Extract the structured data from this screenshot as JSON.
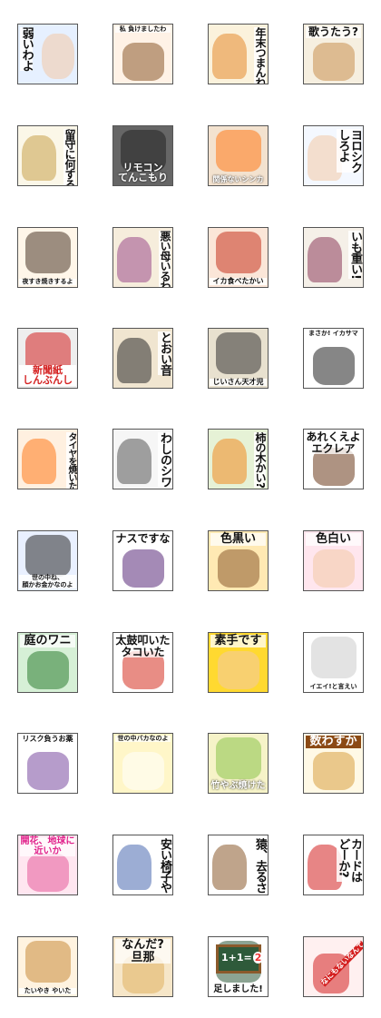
{
  "stickers": [
    {
      "text": "弱いわよ",
      "bg": "#e6f0ff",
      "accent": "#f3c8a5",
      "layout": "vert-left",
      "icon": "hand-icon"
    },
    {
      "text": "私 負けましたわ",
      "bg": "#fff2e6",
      "accent": "#8b5a2b",
      "layout": "top",
      "icon": "girl-icon"
    },
    {
      "text": "年末つまんね",
      "bg": "#fbf2dc",
      "accent": "#e68a2e",
      "layout": "vert-right",
      "icon": "room-icon"
    },
    {
      "text": "歌うたう?",
      "bg": "#f6efe0",
      "accent": "#c89050",
      "layout": "top-right",
      "icon": "singer-icon"
    },
    {
      "text": "留守に何する",
      "bg": "#fbf7e8",
      "accent": "#c9a24a",
      "layout": "vert-right",
      "icon": "clock-window-icon"
    },
    {
      "text": "リモコン\nてんこもり",
      "bg": "#666666",
      "accent": "#222222",
      "layout": "bottom-light",
      "icon": "remotes-icon"
    },
    {
      "text": "関係ないシンカ",
      "bg": "#f3e2cf",
      "accent": "#ff7a1a",
      "layout": "bottom-light",
      "icon": "couple-icon"
    },
    {
      "text": "ヨロシク\nしろよ",
      "bg": "#f4f8ff",
      "accent": "#f3c8a5",
      "layout": "vert-right",
      "icon": "thumb-icon"
    },
    {
      "text": "夜すき焼きするよ",
      "bg": "#fff6e9",
      "accent": "#4a3728",
      "layout": "bottom-dark",
      "icon": "hotpot-icon"
    },
    {
      "text": "悪い母いるわ",
      "bg": "#f6eddc",
      "accent": "#9a4a8a",
      "layout": "vert-right",
      "icon": "mother-icon"
    },
    {
      "text": "イカ食べたかい",
      "bg": "#fbe6d8",
      "accent": "#c7331f",
      "layout": "bottom-dark",
      "icon": "squid-icon"
    },
    {
      "text": "いも重い!",
      "bg": "#f5f0e8",
      "accent": "#8b3a5a",
      "layout": "vert-right",
      "icon": "potato-icon"
    },
    {
      "text": "新聞紙\nしんぶんし",
      "bg": "#eeeeee",
      "accent": "#d42020",
      "layout": "bottom-red",
      "icon": "newspaper-icon"
    },
    {
      "text": "とおい音",
      "bg": "#f0e5d0",
      "accent": "#2a2a2a",
      "layout": "vert-right",
      "icon": "ear-icon"
    },
    {
      "text": "じいさん天才児",
      "bg": "#e8e1cf",
      "accent": "#333333",
      "layout": "bottom-dark",
      "icon": "graduate-icon"
    },
    {
      "text": "まさか! イカサマ",
      "bg": "#ffffff",
      "accent": "#222222",
      "layout": "top",
      "icon": "dice-icon"
    },
    {
      "text": "タイヤを焼いた",
      "bg": "#fff0e0",
      "accent": "#ff7a1a",
      "layout": "vert-right",
      "icon": "tire-icon"
    },
    {
      "text": "わしのシワ",
      "bg": "#f6f6f6",
      "accent": "#555555",
      "layout": "vert-right",
      "icon": "oldman-icon"
    },
    {
      "text": "柿の木かい?",
      "bg": "#e6f2d6",
      "accent": "#f08a20",
      "layout": "vert-right",
      "icon": "persimmon-icon"
    },
    {
      "text": "あれくえよ\nエクレア",
      "bg": "#ffffff",
      "accent": "#6b3a1c",
      "layout": "top",
      "icon": "eclair-icon"
    },
    {
      "text": "世の中ね、\n顔かお金かなのよ",
      "bg": "#e9f0ff",
      "accent": "#2a2a2a",
      "layout": "bottom-dark",
      "icon": "woman-money-icon"
    },
    {
      "text": "ナスですな",
      "bg": "#ffffff",
      "accent": "#5a2a7a",
      "layout": "top",
      "icon": "eggplant-icon"
    },
    {
      "text": "色黒い",
      "bg": "#ffe9b3",
      "accent": "#8b5a2b",
      "layout": "top",
      "icon": "tan-girl-icon"
    },
    {
      "text": "色白い",
      "bg": "#ffe6ee",
      "accent": "#f3c8a5",
      "layout": "top",
      "icon": "pale-girl-icon"
    },
    {
      "text": "庭のワニ",
      "bg": "#d6f0d6",
      "accent": "#2e7d32",
      "layout": "top",
      "icon": "crocodile-icon"
    },
    {
      "text": "太鼓叩いた\nタコいた",
      "bg": "#ffffff",
      "accent": "#d63020",
      "layout": "top",
      "icon": "octopus-icon"
    },
    {
      "text": "素手です",
      "bg": "#ffd930",
      "accent": "#f3c8a5",
      "layout": "top",
      "icon": "hands-icon"
    },
    {
      "text": "イエイ!と言えい",
      "bg": "#ffffff",
      "accent": "#cccccc",
      "layout": "bottom-dark",
      "icon": "rabbit-icon"
    },
    {
      "text": "リスク負うお薬",
      "bg": "#ffffff",
      "accent": "#7a4aa0",
      "layout": "top",
      "icon": "medicine-icon"
    },
    {
      "text": "世の中バカなのよ",
      "bg": "#fff6c8",
      "accent": "#ffffff",
      "layout": "top",
      "icon": "bunny-icon"
    },
    {
      "text": "竹やぶ焼けた",
      "bg": "#f6f3c8",
      "accent": "#8bc34a",
      "layout": "bottom-light",
      "icon": "bamboo-icon"
    },
    {
      "text": "数わすか",
      "bg": "#fff9e6",
      "accent": "#d9a040",
      "layout": "top-band",
      "icon": "bears-icon"
    },
    {
      "text": "開花、地球に\n近いか",
      "bg": "#ffe6f0",
      "accent": "#e65a9a",
      "layout": "top-band-pink",
      "icon": "blossom-icon"
    },
    {
      "text": "安い椅子や",
      "bg": "#ffffff",
      "accent": "#4a6ab0",
      "layout": "vert-right",
      "icon": "chair-icon"
    },
    {
      "text": "猿、去るさ",
      "bg": "#ffffff",
      "accent": "#8b5a2b",
      "layout": "vert-right",
      "icon": "monkey-icon"
    },
    {
      "text": "カードは\nどーか?",
      "bg": "#ffffff",
      "accent": "#d42020",
      "layout": "vert-right",
      "icon": "card-icon"
    },
    {
      "text": "たいやき やいた",
      "bg": "#fff3e0",
      "accent": "#c98a3a",
      "layout": "bottom-dark",
      "icon": "taiyaki-icon"
    },
    {
      "text": "なんだ?\n旦那",
      "bg": "#f6e6c8",
      "accent": "#e0b060",
      "layout": "top-right",
      "icon": "danna-icon"
    },
    {
      "text": "足しました!",
      "bg": "#ffffff",
      "accent": "#2e5a3a",
      "layout": "bottom-dark",
      "icon": "blackboard-icon"
    },
    {
      "text": "なにもないなんて",
      "bg": "#fff0f0",
      "accent": "#d42020",
      "layout": "diag",
      "icon": "chef-icon"
    }
  ],
  "board_formula": {
    "lhs": "1+1=",
    "rhs": "2"
  }
}
